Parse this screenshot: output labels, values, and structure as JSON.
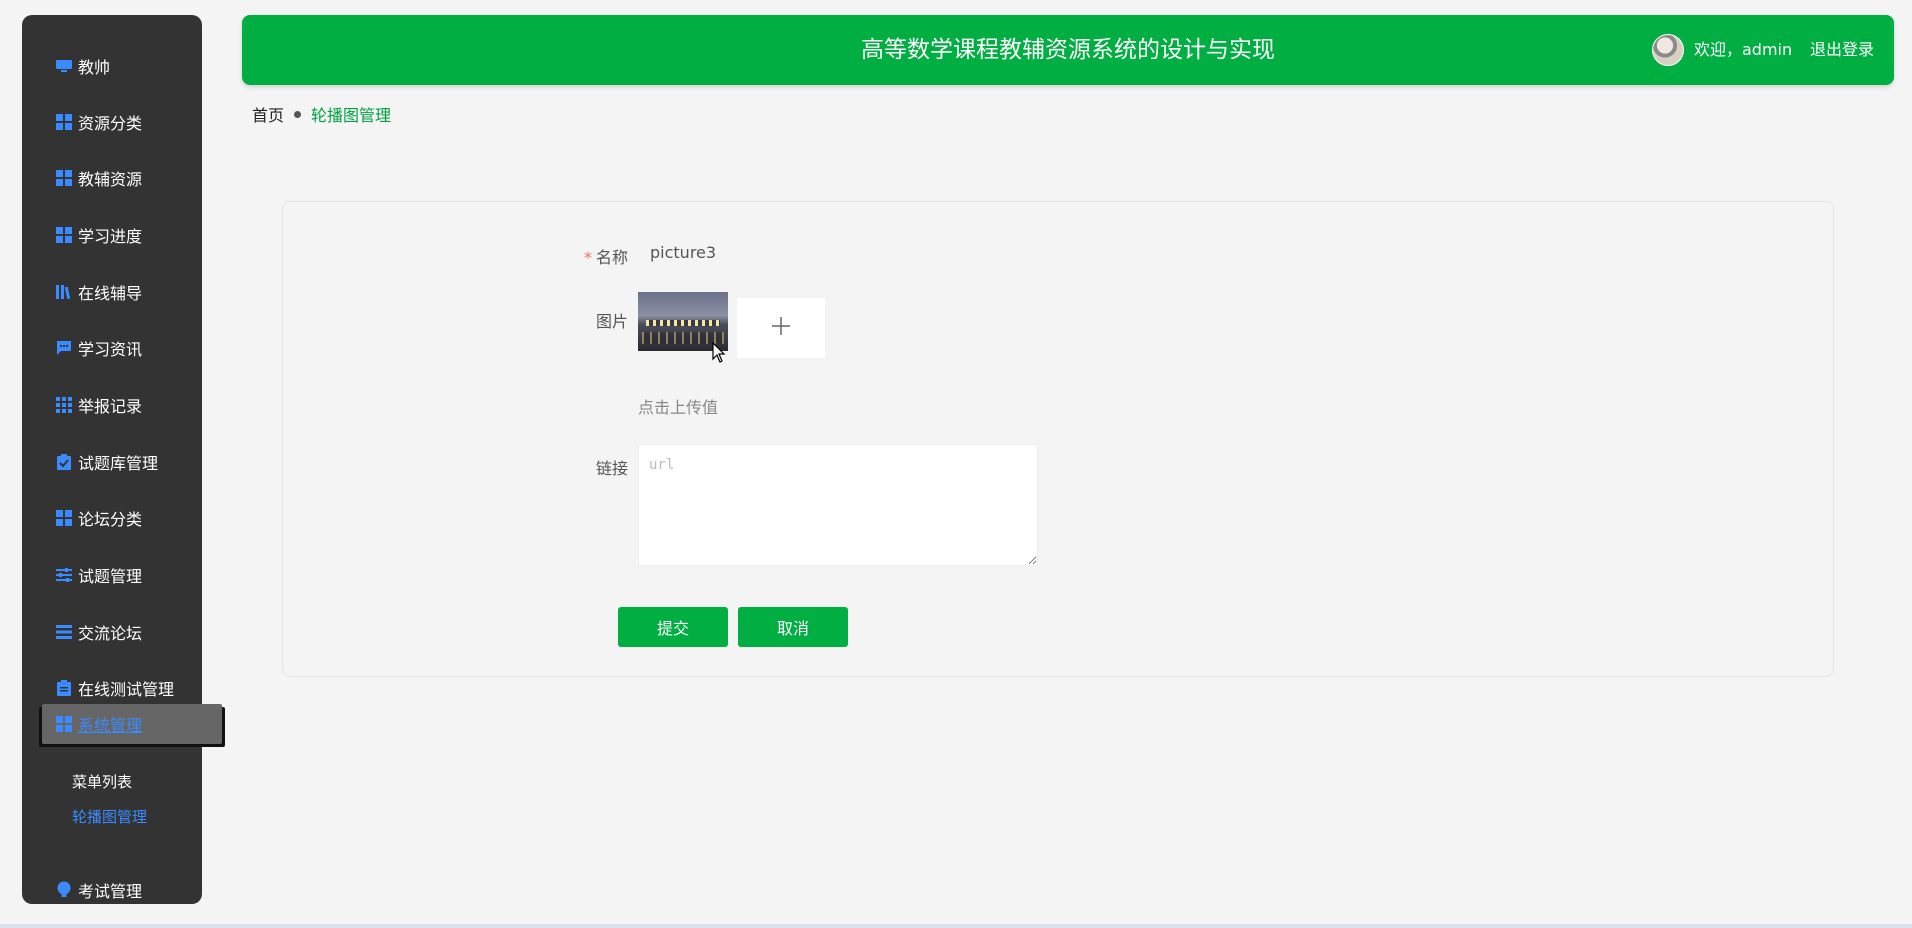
{
  "sidebar": {
    "items": [
      {
        "label": "教帅",
        "icon": "monitor-icon"
      },
      {
        "label": "资源分类",
        "icon": "grid-icon"
      },
      {
        "label": "教辅资源",
        "icon": "grid-icon"
      },
      {
        "label": "学习进度",
        "icon": "grid-icon"
      },
      {
        "label": "在线辅导",
        "icon": "library-icon"
      },
      {
        "label": "学习资讯",
        "icon": "chat-icon"
      },
      {
        "label": "举报记录",
        "icon": "apps-icon"
      },
      {
        "label": "试题库管理",
        "icon": "clipboard-check-icon"
      },
      {
        "label": "论坛分类",
        "icon": "grid-icon"
      },
      {
        "label": "试题管理",
        "icon": "sliders-icon"
      },
      {
        "label": "交流论坛",
        "icon": "list-icon"
      },
      {
        "label": "在线测试管理",
        "icon": "clipboard-icon"
      },
      {
        "label": "系统管理",
        "icon": "grid-icon"
      },
      {
        "label": "考试管理",
        "icon": "bulb-icon"
      }
    ],
    "submenu": [
      {
        "label": "菜单列表"
      },
      {
        "label": "轮播图管理"
      }
    ],
    "accent_color": "#3a8bff",
    "background": "#333333"
  },
  "header": {
    "title": "高等数学课程教辅资源系统的设计与实现",
    "welcome": "欢迎，admin",
    "logout": "退出登录",
    "brand_color": "#00ae42"
  },
  "breadcrumb": {
    "home": "首页",
    "current": "轮播图管理"
  },
  "form": {
    "name_label": "名称",
    "name_required_mark": "*",
    "name_value": "picture3",
    "image_label": "图片",
    "upload_icon": "plus-icon",
    "upload_hint": "点击上传值",
    "link_label": "链接",
    "link_placeholder": "url",
    "link_value": "",
    "submit_label": "提交",
    "cancel_label": "取消"
  }
}
